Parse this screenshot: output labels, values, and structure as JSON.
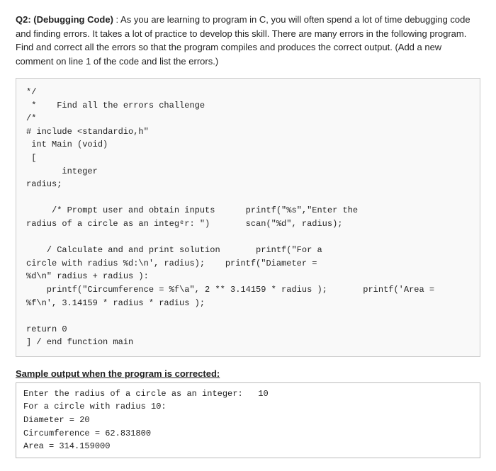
{
  "question": {
    "label": "Q2: (Debugging Code)",
    "body": " : As you are learning to program in C, you will often spend a lot of time debugging code and finding errors. It takes a lot of practice to develop this skill. There are many errors in the following program. Find and correct all the errors so that the program compiles and produces the correct output. (Add a new comment on line 1 of the code and list the errors.)"
  },
  "code": "*/\n *    Find all the errors challenge\n/*\n# include <standardio,h\"\n int Main (void)\n [\n       integer\nradius;\n\n     /* Prompt user and obtain inputs      printf(\"%s\",\"Enter the\nradius of a circle as an integᵉr: \")       scan(\"%d\", radius);\n\n    / Calculate and and print solution       printf(\"For a\ncircle with radius %d:\\n', radius);    printf(\"Diameter =\n%d\\n\" radius + radius ):\n    printf(\"Circumference = %f\\a\", 2 ** 3.14159 * radius );       printf('Area =\n%f\\n', 3.14159 * radius * radius );\n\nreturn 0\n] / end function main",
  "sample_label": "Sample output when the program is corrected:",
  "sample_output": "Enter the radius of a circle as an integer:   10\nFor a circle with radius 10:\nDiameter = 20\nCircumference = 62.831800\nArea = 314.159000"
}
